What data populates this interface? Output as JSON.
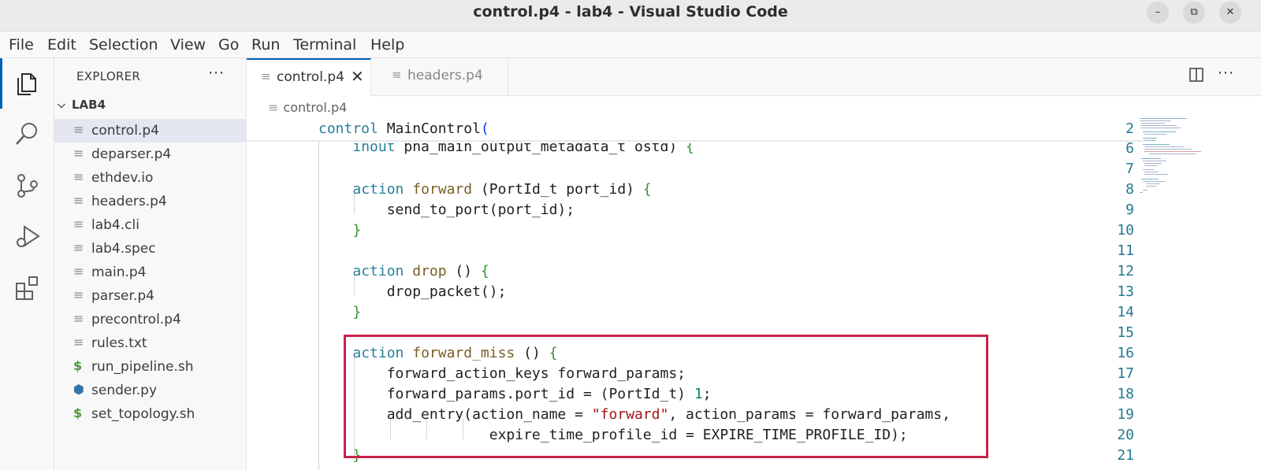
{
  "window": {
    "title": "control.p4 - lab4 - Visual Studio Code",
    "controls": [
      "–",
      "⧉",
      "✕"
    ]
  },
  "menu": [
    "File",
    "Edit",
    "Selection",
    "View",
    "Go",
    "Run",
    "Terminal",
    "Help"
  ],
  "activity_bar": [
    "files-icon",
    "search-icon",
    "source-control-icon",
    "run-debug-icon",
    "extensions-icon"
  ],
  "explorer": {
    "title": "EXPLORER",
    "more": "···",
    "folder": "LAB4",
    "files": [
      {
        "name": "control.p4",
        "icon": "file-lines-icon",
        "active": true
      },
      {
        "name": "deparser.p4",
        "icon": "file-lines-icon"
      },
      {
        "name": "ethdev.io",
        "icon": "file-lines-icon"
      },
      {
        "name": "headers.p4",
        "icon": "file-lines-icon"
      },
      {
        "name": "lab4.cli",
        "icon": "file-lines-icon"
      },
      {
        "name": "lab4.spec",
        "icon": "file-lines-icon"
      },
      {
        "name": "main.p4",
        "icon": "file-lines-icon"
      },
      {
        "name": "parser.p4",
        "icon": "file-lines-icon"
      },
      {
        "name": "precontrol.p4",
        "icon": "file-lines-icon"
      },
      {
        "name": "rules.txt",
        "icon": "file-lines-icon"
      },
      {
        "name": "run_pipeline.sh",
        "icon": "shell-icon"
      },
      {
        "name": "sender.py",
        "icon": "python-icon"
      },
      {
        "name": "set_topology.sh",
        "icon": "shell-icon"
      }
    ]
  },
  "tabs": [
    {
      "label": "control.p4",
      "active": true,
      "close": "✕"
    },
    {
      "label": "headers.p4",
      "active": false
    }
  ],
  "breadcrumb": "control.p4",
  "editor": {
    "sticky": {
      "num": "2",
      "text": "control MainControl("
    },
    "lines": [
      {
        "num": "6",
        "text": "    inout pna_main_output_metadata_t ostd) {"
      },
      {
        "num": "7",
        "text": ""
      },
      {
        "num": "8",
        "text": "    action forward (PortId_t port_id) {"
      },
      {
        "num": "9",
        "text": "        send_to_port(port_id);"
      },
      {
        "num": "10",
        "text": "    }"
      },
      {
        "num": "11",
        "text": ""
      },
      {
        "num": "12",
        "text": "    action drop () {"
      },
      {
        "num": "13",
        "text": "        drop_packet();"
      },
      {
        "num": "14",
        "text": "    }"
      },
      {
        "num": "15",
        "text": ""
      },
      {
        "num": "16",
        "text": "    action forward_miss () {"
      },
      {
        "num": "17",
        "text": "        forward_action_keys forward_params;"
      },
      {
        "num": "18",
        "text": "        forward_params.port_id = (PortId_t) 1;"
      },
      {
        "num": "19",
        "text": "        add_entry(action_name = \"forward\", action_params = forward_params,"
      },
      {
        "num": "20",
        "text": "                    expire_time_profile_id = EXPIRE_TIME_PROFILE_ID);"
      },
      {
        "num": "21",
        "text": "    }"
      }
    ]
  },
  "colors": {
    "accent": "#005fb8",
    "highlight_box": "#c8234a",
    "line_number": "#237893"
  }
}
